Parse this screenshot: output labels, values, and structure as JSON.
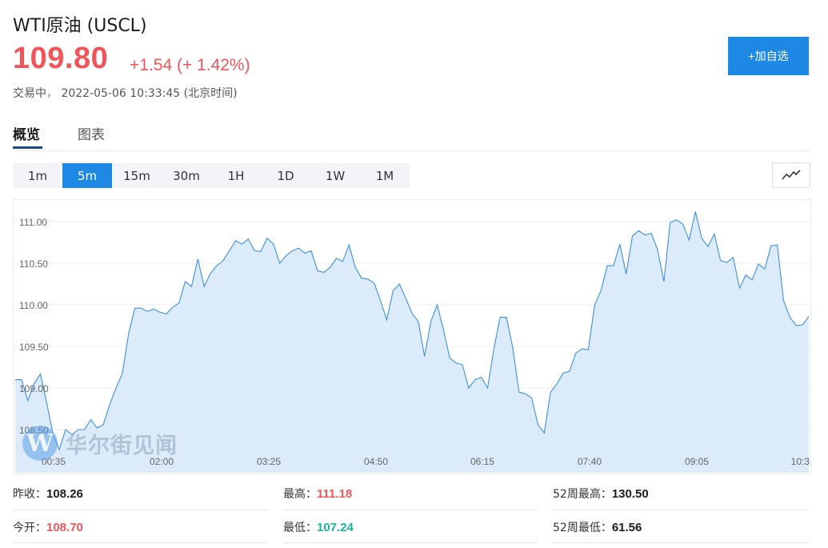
{
  "header": {
    "title": "WTI原油 (USCL)",
    "price": "109.80",
    "change": "+1.54 (+ 1.42%)",
    "status_label": "交易中",
    "status_sep": "，",
    "timestamp": "2022-05-06 10:33:45",
    "timezone": "(北京时间)",
    "add_button": "+加自选"
  },
  "tabs": [
    {
      "label": "概览",
      "active": true
    },
    {
      "label": "图表",
      "active": false
    }
  ],
  "periods": [
    {
      "label": "1m",
      "active": false
    },
    {
      "label": "5m",
      "active": true
    },
    {
      "label": "15m",
      "active": false
    },
    {
      "label": "30m",
      "active": false
    },
    {
      "label": "1H",
      "active": false
    },
    {
      "label": "1D",
      "active": false
    },
    {
      "label": "1W",
      "active": false
    },
    {
      "label": "1M",
      "active": false
    }
  ],
  "chart_type_icon": "line-chart-icon",
  "watermark": {
    "logo": "W",
    "text": "华尔街见闻"
  },
  "colors": {
    "up": "#f0555a",
    "down": "#17b29a",
    "accent": "#1e88e5",
    "line": "#3d8fe0",
    "area": "#dcebfa"
  },
  "chart_data": {
    "type": "area",
    "y_ticks": [
      "111.00",
      "110.50",
      "110.00",
      "109.50",
      "109.00",
      "108.50"
    ],
    "x_ticks": [
      "00:35",
      "02:00",
      "03:25",
      "04:50",
      "06:15",
      "07:40",
      "09:05",
      "10:3"
    ],
    "ylim": [
      108.2,
      111.2
    ],
    "grid": true,
    "series": [
      {
        "values": [
          109.1,
          109.1,
          108.85,
          109.05,
          109.17,
          108.82,
          108.45,
          108.26,
          108.5,
          108.44,
          108.5,
          108.5,
          108.62,
          108.52,
          108.56,
          108.8,
          109.0,
          109.17,
          109.65,
          109.96,
          109.96,
          109.92,
          109.95,
          109.91,
          109.89,
          109.97,
          110.02,
          110.28,
          110.22,
          110.55,
          110.22,
          110.38,
          110.47,
          110.53,
          110.65,
          110.77,
          110.73,
          110.79,
          110.65,
          110.64,
          110.8,
          110.73,
          110.5,
          110.59,
          110.65,
          110.68,
          110.62,
          110.65,
          110.41,
          110.39,
          110.45,
          110.56,
          110.52,
          110.72,
          110.45,
          110.32,
          110.31,
          110.26,
          110.05,
          109.82,
          110.17,
          110.25,
          110.08,
          109.9,
          109.8,
          109.38,
          109.8,
          110.0,
          109.7,
          109.36,
          109.3,
          109.28,
          109.0,
          109.1,
          109.13,
          109.0,
          109.47,
          109.85,
          109.85,
          109.48,
          108.95,
          108.93,
          108.88,
          108.56,
          108.46,
          108.95,
          109.05,
          109.18,
          109.2,
          109.42,
          109.47,
          109.46,
          110.0,
          110.17,
          110.47,
          110.47,
          110.73,
          110.37,
          110.83,
          110.89,
          110.84,
          110.86,
          110.66,
          110.28,
          110.99,
          111.02,
          110.97,
          110.78,
          111.12,
          110.8,
          110.7,
          110.85,
          110.53,
          110.51,
          110.57,
          110.2,
          110.36,
          110.3,
          110.49,
          110.43,
          110.71,
          110.72,
          110.05,
          109.85,
          109.75,
          109.76,
          109.86
        ]
      }
    ]
  },
  "stats": [
    {
      "label": "昨收：",
      "value": "108.26",
      "tone": "dark"
    },
    {
      "label": "最高：",
      "value": "111.18",
      "tone": "red"
    },
    {
      "label": "52周最高：",
      "value": "130.50",
      "tone": "dark"
    },
    {
      "label": "今开：",
      "value": "108.70",
      "tone": "red"
    },
    {
      "label": "最低：",
      "value": "107.24",
      "tone": "green"
    },
    {
      "label": "52周最低：",
      "value": "61.56",
      "tone": "dark"
    }
  ]
}
